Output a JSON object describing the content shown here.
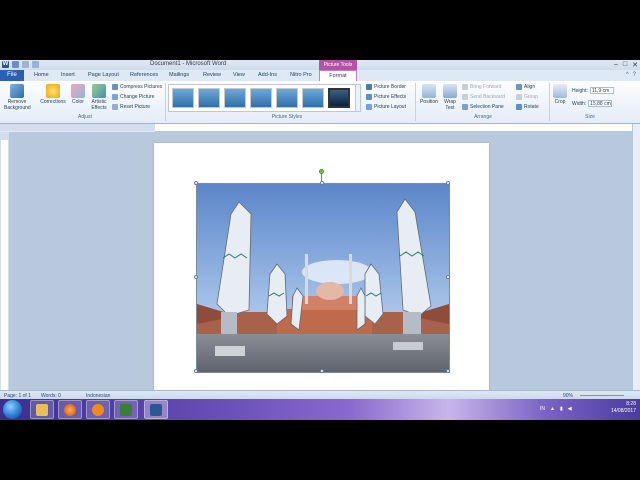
{
  "window": {
    "title": "Document1 - Microsoft Word",
    "context_tab_group": "Picture Tools"
  },
  "tabs": [
    "File",
    "Home",
    "Insert",
    "Page Layout",
    "References",
    "Mailings",
    "Review",
    "View",
    "Add-Ins",
    "Nitro Pro",
    "Format"
  ],
  "active_tab": "Format",
  "ribbon": {
    "adjust": {
      "label": "Adjust",
      "remove_background": "Remove Background",
      "corrections": "Corrections",
      "color": "Color",
      "artistic_effects": "Artistic Effects",
      "compress_pictures": "Compress Pictures",
      "change_picture": "Change Picture",
      "reset_picture": "Reset Picture"
    },
    "picture_styles": {
      "label": "Picture Styles",
      "picture_border": "Picture Border",
      "picture_effects": "Picture Effects",
      "picture_layout": "Picture Layout"
    },
    "arrange": {
      "label": "Arrange",
      "position": "Position",
      "wrap_text": "Wrap Text",
      "bring_forward": "Bring Forward",
      "send_backward": "Send Backward",
      "selection_pane": "Selection Pane",
      "align": "Align",
      "group": "Group",
      "rotate": "Rotate"
    },
    "size": {
      "label": "Size",
      "crop": "Crop",
      "height_label": "Height:",
      "height_value": "11,9 cm",
      "width_label": "Width:",
      "width_value": "15,88 cm"
    }
  },
  "status_bar": {
    "page": "Page: 1 of 1",
    "words": "Words: 0",
    "language": "Indonesian",
    "zoom": "90%"
  },
  "taskbar": {
    "tray_lang": "IN",
    "time": "8:28",
    "date": "14/08/2017"
  },
  "colors": {
    "ribbon_bg": "#e3ecf7",
    "file_tab": "#2b5fb4",
    "context_tab": "#b653a7",
    "taskbar": "#6a4fb8"
  }
}
